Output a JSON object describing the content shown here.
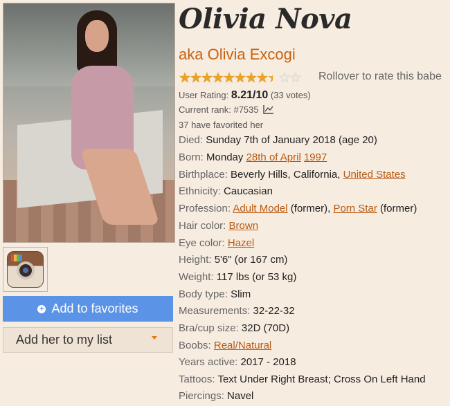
{
  "profile": {
    "name": "Olivia Nova",
    "aka": "aka Olivia Excogi",
    "rollover": "Rollover to rate this babe",
    "rating_label": "User Rating:",
    "rating_value": "8.21/10",
    "rating_votes": "(33 votes)",
    "rating_fraction": 0.821,
    "rank": "Current rank: #7535",
    "favorited": "37 have favorited her"
  },
  "buttons": {
    "favorites": "Add to favorites",
    "list": "Add her to my list"
  },
  "details": {
    "died_label": "Died:",
    "died_value": "Sunday 7th of January 2018 (age 20)",
    "born_label": "Born:",
    "born_value": "Monday",
    "born_link1": "28th of April",
    "born_link2": "1997",
    "birthplace_label": "Birthplace:",
    "birthplace_value": "Beverly Hills, California,",
    "birthplace_link": "United States",
    "ethnicity_label": "Ethnicity:",
    "ethnicity_value": "Caucasian",
    "profession_label": "Profession:",
    "profession_link1": "Adult Model",
    "profession_mid": "(former),",
    "profession_link2": "Porn Star",
    "profession_end": "(former)",
    "hair_label": "Hair color:",
    "hair_link": "Brown",
    "eye_label": "Eye color:",
    "eye_link": "Hazel",
    "height_label": "Height:",
    "height_value": "5'6\" (or 167 cm)",
    "weight_label": "Weight:",
    "weight_value": "117 lbs (or 53 kg)",
    "body_label": "Body type:",
    "body_value": "Slim",
    "measure_label": "Measurements:",
    "measure_value": "32-22-32",
    "bra_label": "Bra/cup size:",
    "bra_value": "32D (70D)",
    "boobs_label": "Boobs:",
    "boobs_link": "Real/Natural",
    "years_label": "Years active:",
    "years_value": "2017 - 2018",
    "tattoos_label": "Tattoos:",
    "tattoos_value": "Text Under Right Breast; Cross On Left Hand",
    "piercings_label": "Piercings:",
    "piercings_value": "Navel"
  },
  "colors": {
    "accent": "#c8620e",
    "link": "#b85a12",
    "button": "#5b93e6",
    "background": "#f7ece0",
    "star": "#f0a21e"
  },
  "icons": {
    "social": "instagram-icon",
    "rank": "line-chart-icon",
    "fav": "plus-circle-icon",
    "list": "caret-down-icon"
  }
}
